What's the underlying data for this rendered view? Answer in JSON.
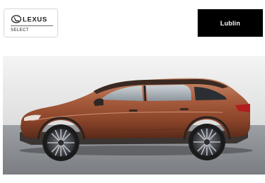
{
  "brand": {
    "name": "LEXUS",
    "tagline": "SELECT"
  },
  "location": {
    "label": "Lublin"
  },
  "colors": {
    "badge_background": "#000000",
    "car_body": "#a65a3c"
  },
  "photo": {
    "icon": "car-side-photo"
  }
}
